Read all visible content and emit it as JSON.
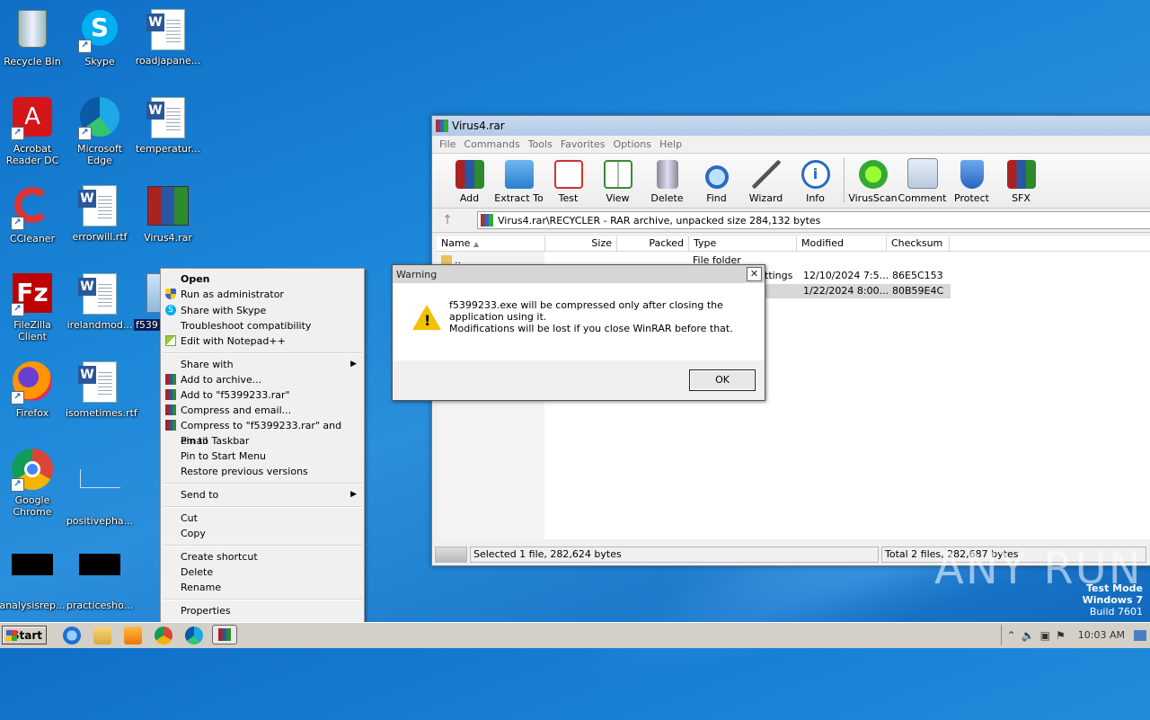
{
  "desktop": {
    "icons": [
      {
        "label": "Recycle Bin"
      },
      {
        "label": "Skype"
      },
      {
        "label": "roadjapane..."
      },
      {
        "label": "Acrobat Reader DC"
      },
      {
        "label": "Microsoft Edge"
      },
      {
        "label": "temperatur..."
      },
      {
        "label": "CCleaner"
      },
      {
        "label": "errorwill.rtf"
      },
      {
        "label": "Virus4.rar"
      },
      {
        "label": "FileZilla Client"
      },
      {
        "label": "irelandmod..."
      },
      {
        "label": "f539"
      },
      {
        "label": "Firefox"
      },
      {
        "label": "isometimes.rtf"
      },
      {
        "label": "Google Chrome"
      },
      {
        "label": "positivepha..."
      },
      {
        "label": "analysisrep..."
      },
      {
        "label": "practicesho..."
      }
    ]
  },
  "winrar": {
    "title": "Virus4.rar",
    "menu": [
      "File",
      "Commands",
      "Tools",
      "Favorites",
      "Options",
      "Help"
    ],
    "toolbar": [
      "Add",
      "Extract To",
      "Test",
      "View",
      "Delete",
      "Find",
      "Wizard",
      "Info",
      "VirusScan",
      "Comment",
      "Protect",
      "SFX"
    ],
    "path": "Virus4.rar\\RECYCLER - RAR archive, unpacked size 284,132 bytes",
    "columns": [
      "Name",
      "Size",
      "Packed",
      "Type",
      "Modified",
      "Checksum"
    ],
    "rows": [
      {
        "name": "..",
        "type": "File folder",
        "modified": "",
        "checksum": ""
      },
      {
        "name": "",
        "type": "ttings",
        "modified": "12/10/2024 7:5...",
        "checksum": "86E5C153"
      },
      {
        "name": "",
        "type": "",
        "modified": "1/22/2024 8:00...",
        "checksum": "80B59E4C"
      }
    ],
    "status_left": "Selected 1 file, 282,624 bytes",
    "status_right": "Total 2 files, 282,687 bytes"
  },
  "dialog": {
    "title": "Warning",
    "close": "✕",
    "message_line1": "f5399233.exe will be compressed only after closing the application using it.",
    "message_line2": "Modifications will be lost if you close WinRAR before that.",
    "ok": "OK"
  },
  "context_menu": {
    "items": [
      "Open",
      "Run as administrator",
      "Share with Skype",
      "Troubleshoot compatibility",
      "Edit with Notepad++",
      "Share with",
      "Add to archive...",
      "Add to \"f5399233.rar\"",
      "Compress and email...",
      "Compress to \"f5399233.rar\" and email",
      "Pin to Taskbar",
      "Pin to Start Menu",
      "Restore previous versions",
      "Send to",
      "Cut",
      "Copy",
      "Create shortcut",
      "Delete",
      "Rename",
      "Properties"
    ]
  },
  "taskbar": {
    "start": "Start",
    "clock": "10:03 AM"
  },
  "watermark": {
    "line1": "Test Mode",
    "line2": "Windows 7",
    "line3": "Build 7601",
    "brand": "ANY RUN"
  }
}
